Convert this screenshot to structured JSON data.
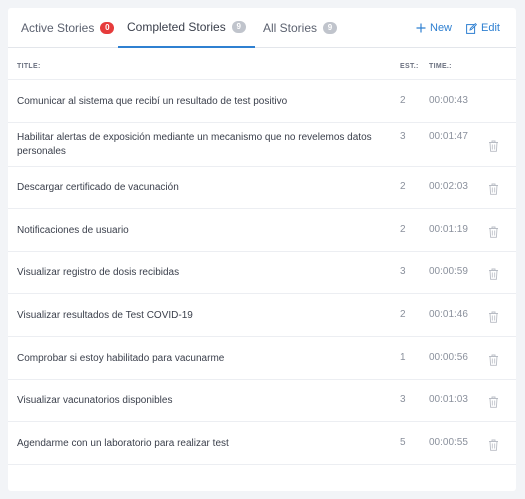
{
  "tabs": [
    {
      "label": "Active Stories",
      "count": "0"
    },
    {
      "label": "Completed Stories",
      "count": "9"
    },
    {
      "label": "All Stories",
      "count": "9"
    }
  ],
  "actions": {
    "new_label": "New",
    "edit_label": "Edit",
    "accent_color": "#2f80d1"
  },
  "table": {
    "headers": {
      "title": "TITLE:",
      "est": "EST.:",
      "time": "TIME.:"
    },
    "rows": [
      {
        "title": "Comunicar al sistema que recibí un resultado de test positivo",
        "est": "2",
        "time": "00:00:43"
      },
      {
        "title": "Habilitar alertas de exposición mediante un mecanismo que no revelemos datos personales",
        "est": "3",
        "time": "00:01:47"
      },
      {
        "title": "Descargar certificado de vacunación",
        "est": "2",
        "time": "00:02:03"
      },
      {
        "title": "Notificaciones de usuario",
        "est": "2",
        "time": "00:01:19"
      },
      {
        "title": "Visualizar registro de dosis recibidas",
        "est": "3",
        "time": "00:00:59"
      },
      {
        "title": "Visualizar resultados de Test COVID-19",
        "est": "2",
        "time": "00:01:46"
      },
      {
        "title": "Comprobar si estoy habilitado para vacunarme",
        "est": "1",
        "time": "00:00:56"
      },
      {
        "title": "Visualizar vacunatorios disponibles",
        "est": "3",
        "time": "00:01:03"
      },
      {
        "title": "Agendarme con un laboratorio para realizar test",
        "est": "5",
        "time": "00:00:55"
      }
    ]
  }
}
